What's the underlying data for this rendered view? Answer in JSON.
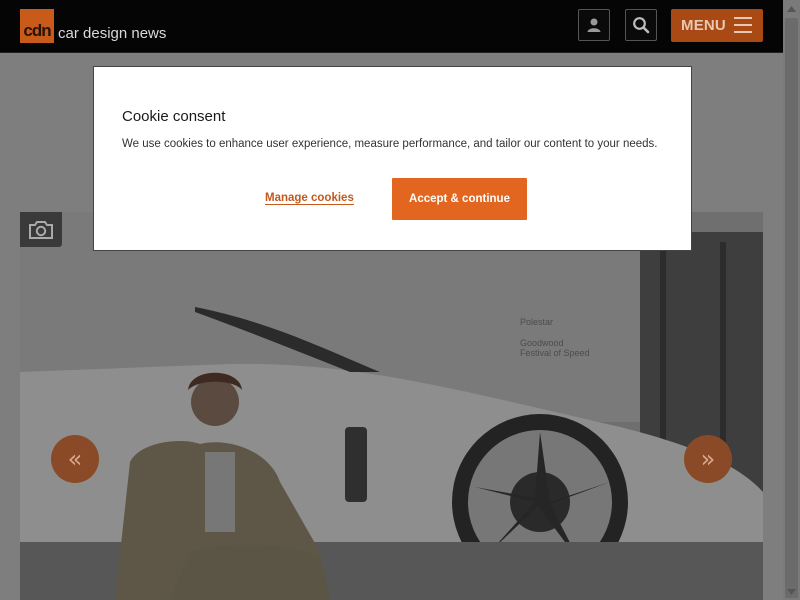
{
  "header": {
    "logo_mark": "cdn",
    "logo_text": "car design news",
    "user_icon": "user-icon",
    "search_icon": "search-icon",
    "menu_label": "MENU",
    "menu_icon": "hamburger-icon"
  },
  "hero": {
    "camera_icon": "camera-icon",
    "prev_arrow": "«",
    "next_arrow": "»",
    "sign_brand": "Polestar",
    "sign_event_line1": "Goodwood",
    "sign_event_line2": "Festival of Speed"
  },
  "cookie_dialog": {
    "title": "Cookie consent",
    "message": "We use cookies to enhance user experience, measure performance, and tailor our content to your needs.",
    "manage_label": "Manage cookies",
    "accept_label": "Accept & continue"
  },
  "colors": {
    "brand_orange": "#e2661f",
    "header_bg": "#050505"
  }
}
